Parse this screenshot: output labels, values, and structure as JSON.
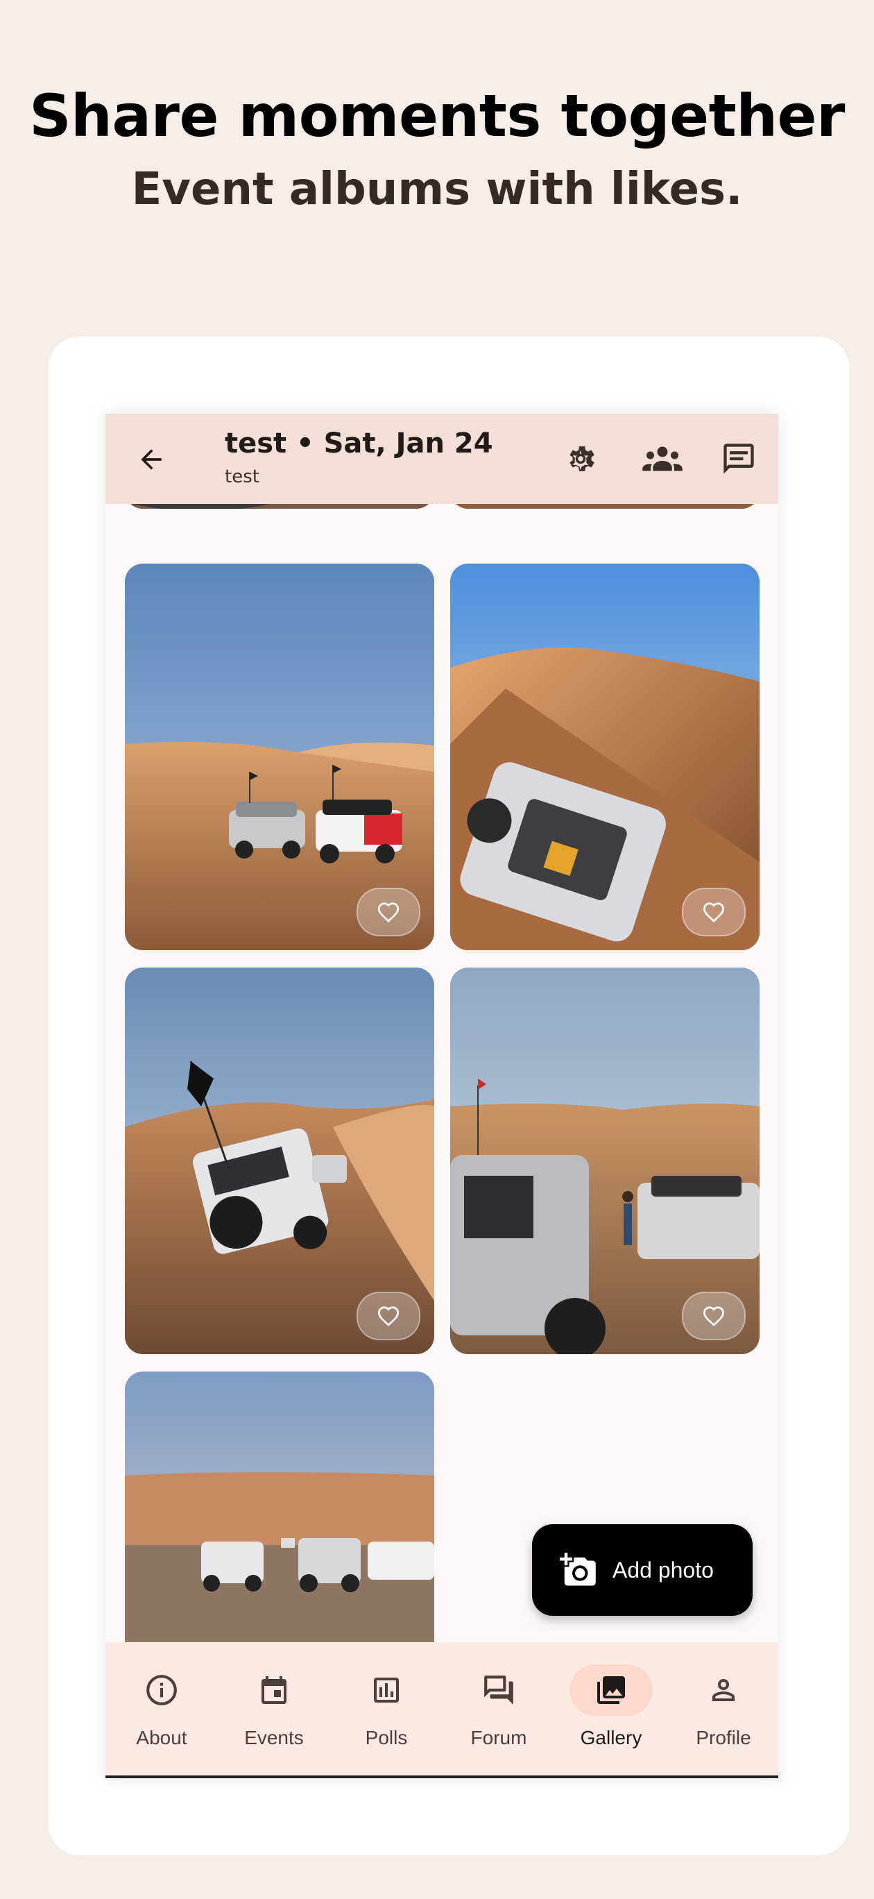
{
  "hero": {
    "title": "Share moments together",
    "subtitle": "Event albums with likes."
  },
  "appbar": {
    "title": "test • Sat, Jan 24",
    "subtitle": "test",
    "icons": [
      "arrow-back-icon",
      "gear-icon",
      "group-icon",
      "chat-icon"
    ]
  },
  "gallery": {
    "photos": [
      {
        "scene": "desert dunes with vehicles (partially scrolled)",
        "liked": false
      },
      {
        "scene": "desert sand (partially scrolled)",
        "liked": false
      },
      {
        "scene": "two SUVs on desert dune under blue sky",
        "liked": false
      },
      {
        "scene": "white SUV descending dune ridge",
        "liked": false
      },
      {
        "scene": "jeep with black flag climbing dune",
        "liked": false
      },
      {
        "scene": "group of vehicles and people in desert",
        "liked": false
      },
      {
        "scene": "row of vehicles with flags before dune",
        "liked": false
      }
    ]
  },
  "fab": {
    "label": "Add photo",
    "icon": "add-photo-icon"
  },
  "nav": {
    "items": [
      {
        "label": "About",
        "icon": "info-icon",
        "active": false
      },
      {
        "label": "Events",
        "icon": "calendar-icon",
        "active": false
      },
      {
        "label": "Polls",
        "icon": "poll-icon",
        "active": false
      },
      {
        "label": "Forum",
        "icon": "forum-icon",
        "active": false
      },
      {
        "label": "Gallery",
        "icon": "gallery-icon",
        "active": true
      },
      {
        "label": "Profile",
        "icon": "person-icon",
        "active": false
      }
    ]
  },
  "colors": {
    "background": "#f5ede8",
    "appbar": "#f2e0d8",
    "nav": "#fbeae4",
    "nav_active": "#fdd8cc",
    "fab": "#000000"
  }
}
